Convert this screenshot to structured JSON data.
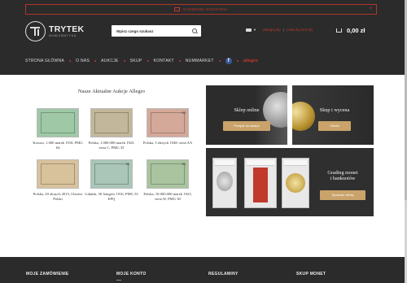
{
  "top_banner": {
    "text": "Darmowa dostawa!",
    "close": "×"
  },
  "logo": {
    "name": "TRYTEK",
    "subtitle": "NUMIZMATYKA"
  },
  "search": {
    "placeholder": "Wpisz czego szukasz"
  },
  "account": {
    "login": "Zaloguj się",
    "separator": "|",
    "wishlist": "Lista Życzeń (0)"
  },
  "cart": {
    "total": "0,00 zł"
  },
  "nav": {
    "items": [
      "Strona główna",
      "O nas",
      "Aukcje",
      "Skup",
      "Kontakt",
      "Nummarket"
    ],
    "facebook": "f",
    "allegro": "allegro"
  },
  "auctions": {
    "title": "Nasze Aktualne Aukcje Allegro",
    "items": [
      {
        "caption": "Kowno, 1.000 marek 1918, PMG 64",
        "number": "",
        "color": "#9fc8a6"
      },
      {
        "caption": "Polska, 1.000.000 marek 1923, seria C, PMG 35",
        "number": "",
        "color": "#c2b79a"
      },
      {
        "caption": "Polska, 5 złotych 1948, seria AA",
        "number": "33",
        "color": "#d4a99a"
      },
      {
        "caption": "Polska, 20 złotych 2015, Chrzest Polski",
        "number": "",
        "color": "#d8c29c"
      },
      {
        "caption": "Gdańsk, 50 fenigów 1916, PMG 55 EPQ",
        "number": "35",
        "color": "#a9c6b8"
      },
      {
        "caption": "Polska, 10.000.000 marek 1923, seria W, PMG 30",
        "number": "30",
        "color": "#a9c49f"
      }
    ]
  },
  "promos": {
    "shop": {
      "title": "Sklep online",
      "button": "Przejdź do sklepu"
    },
    "buy": {
      "title": "Skup i wycena",
      "button": "Oferta"
    },
    "grading": {
      "title_line1": "Grading monet",
      "title_line2": "i banknotów",
      "button": "Sprawdź ofertę"
    }
  },
  "footer": {
    "columns": [
      "Moje zamówienie",
      "Moje konto",
      "Regulaminy",
      "Skup monet"
    ]
  }
}
